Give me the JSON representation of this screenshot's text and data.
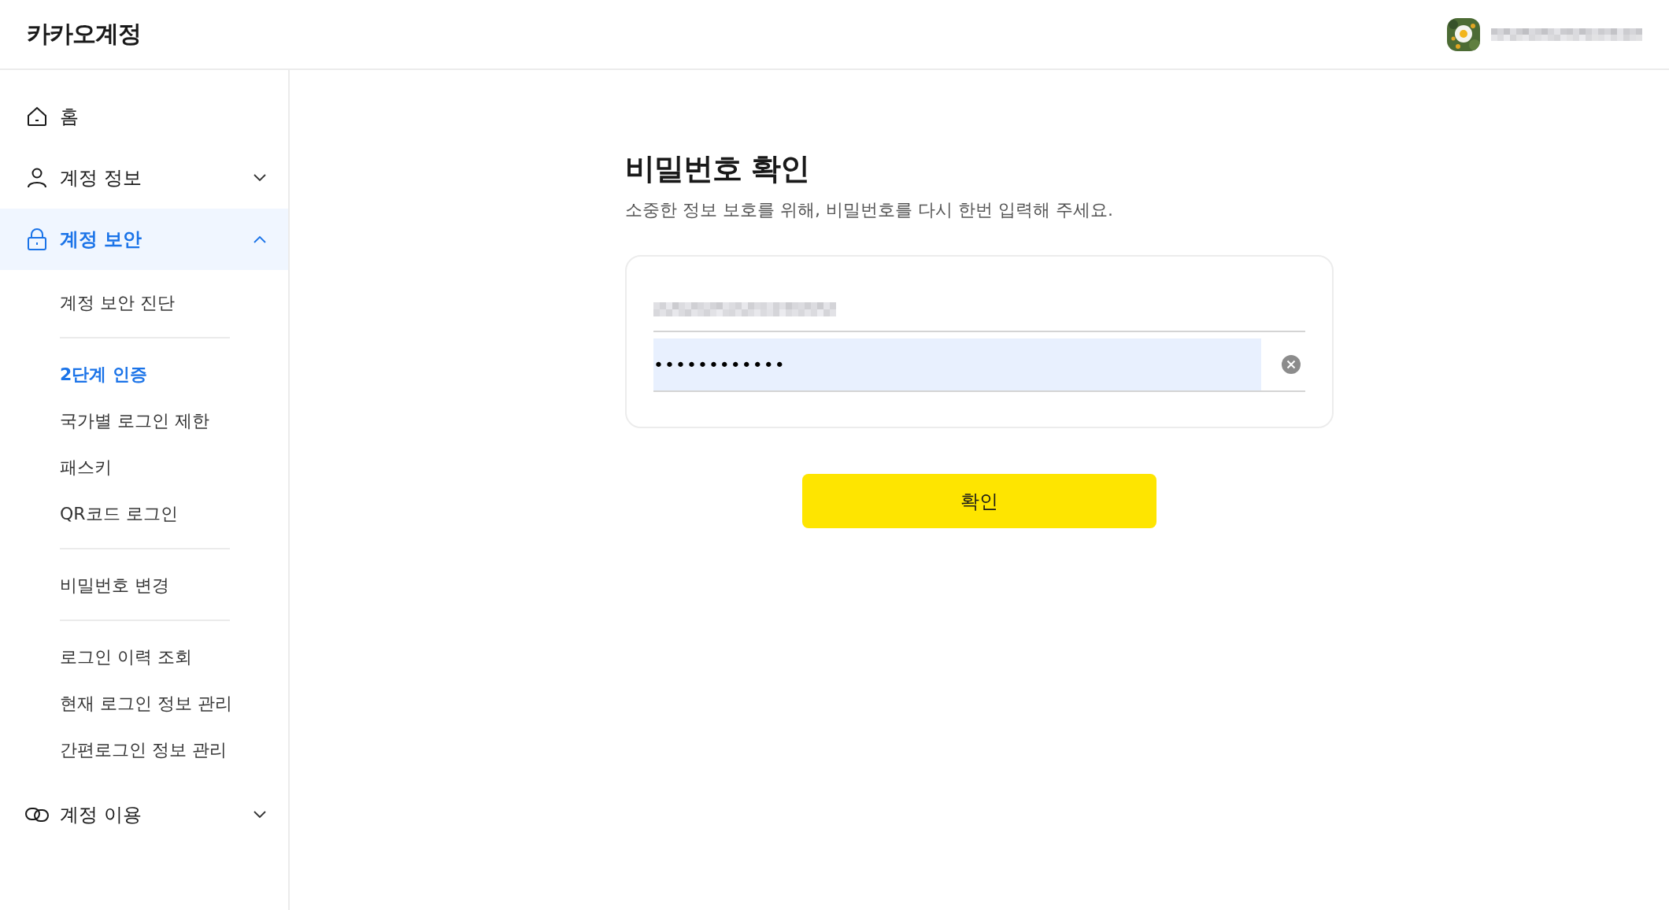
{
  "header": {
    "logo": "카카오계정"
  },
  "sidebar": {
    "items": [
      {
        "label": "홈",
        "selected": false
      },
      {
        "label": "계정 정보",
        "selected": false,
        "expanded": false
      },
      {
        "label": "계정 보안",
        "selected": true,
        "expanded": true,
        "groups": [
          [
            {
              "label": "계정 보안 진단",
              "selected": false
            }
          ],
          [
            {
              "label": "2단계 인증",
              "selected": true
            },
            {
              "label": "국가별 로그인 제한",
              "selected": false
            },
            {
              "label": "패스키",
              "selected": false
            },
            {
              "label": "QR코드 로그인",
              "selected": false
            }
          ],
          [
            {
              "label": "비밀번호 변경",
              "selected": false
            }
          ],
          [
            {
              "label": "로그인 이력 조회",
              "selected": false
            },
            {
              "label": "현재 로그인 정보 관리",
              "selected": false
            },
            {
              "label": "간편로그인 정보 관리",
              "selected": false
            }
          ]
        ]
      },
      {
        "label": "계정 이용",
        "selected": false,
        "expanded": false
      }
    ]
  },
  "main": {
    "title": "비밀번호 확인",
    "subtitle": "소중한 정보 보호를 위해, 비밀번호를 다시 한번 입력해 주세요.",
    "password": {
      "value": "••••••••••••"
    },
    "button": "확인"
  }
}
